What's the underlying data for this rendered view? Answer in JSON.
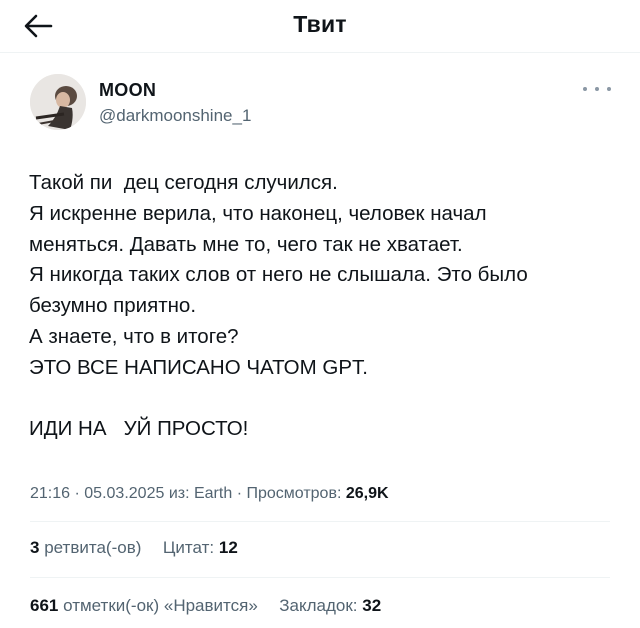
{
  "header": {
    "title": "Твит",
    "back_icon": "arrow-left-icon"
  },
  "author": {
    "name": "MOON",
    "handle": "@darkmoonshine_1"
  },
  "tweet": {
    "lines": [
      "Такой пи  дец сегодня случился.",
      "Я искренне верила, что наконец, человек начал",
      "меняться. Давать мне то, чего так не хватает.",
      "Я никогда таких слов от него не слышала. Это было",
      "безумно приятно.",
      "А знаете, что в итоге?",
      "ЭТО ВСЕ НАПИСАНО ЧАТОМ GPT.",
      "",
      "ИДИ НА   УЙ ПРОСТО!"
    ]
  },
  "meta": {
    "time": "21:16",
    "date": "05.03.2025",
    "source_prefix": "из:",
    "source": "Earth",
    "views_label": "Просмотров:",
    "views": "26,9K",
    "separator": "·"
  },
  "stats": {
    "retweets_count": "3",
    "retweets_label": "ретвита(-ов)",
    "quotes_label": "Цитат:",
    "quotes_count": "12",
    "likes_count": "661",
    "likes_label": "отметки(-ок) «Нравится»",
    "bookmarks_label": "Закладок:",
    "bookmarks_count": "32"
  }
}
